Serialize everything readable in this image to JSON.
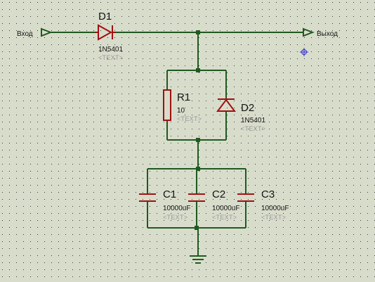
{
  "terminals": {
    "input": "Вход",
    "output": "Выход"
  },
  "components": {
    "d1": {
      "ref": "D1",
      "value": "1N5401",
      "text": "<TEXT>"
    },
    "r1": {
      "ref": "R1",
      "value": "10",
      "text": "<TEXT>"
    },
    "d2": {
      "ref": "D2",
      "value": "1N5401",
      "text": "<TEXT>"
    },
    "c1": {
      "ref": "C1",
      "value": "10000uF",
      "text": "<TEXT>"
    },
    "c2": {
      "ref": "C2",
      "value": "10000uF",
      "text": "<TEXT>"
    },
    "c3": {
      "ref": "C3",
      "value": "10000uF",
      "text": "<TEXT>"
    }
  },
  "colors": {
    "background": "#d8dccb",
    "grid_dot": "#3a3a3a",
    "wire": "#1f5a1f",
    "component": "#a01010",
    "label": "#141414",
    "placeholder_text": "#9a9a9a",
    "cursor": "#2a2ad0"
  },
  "icons": {
    "cursor": "crosshair-cursor-icon",
    "ground": "ground-icon"
  }
}
